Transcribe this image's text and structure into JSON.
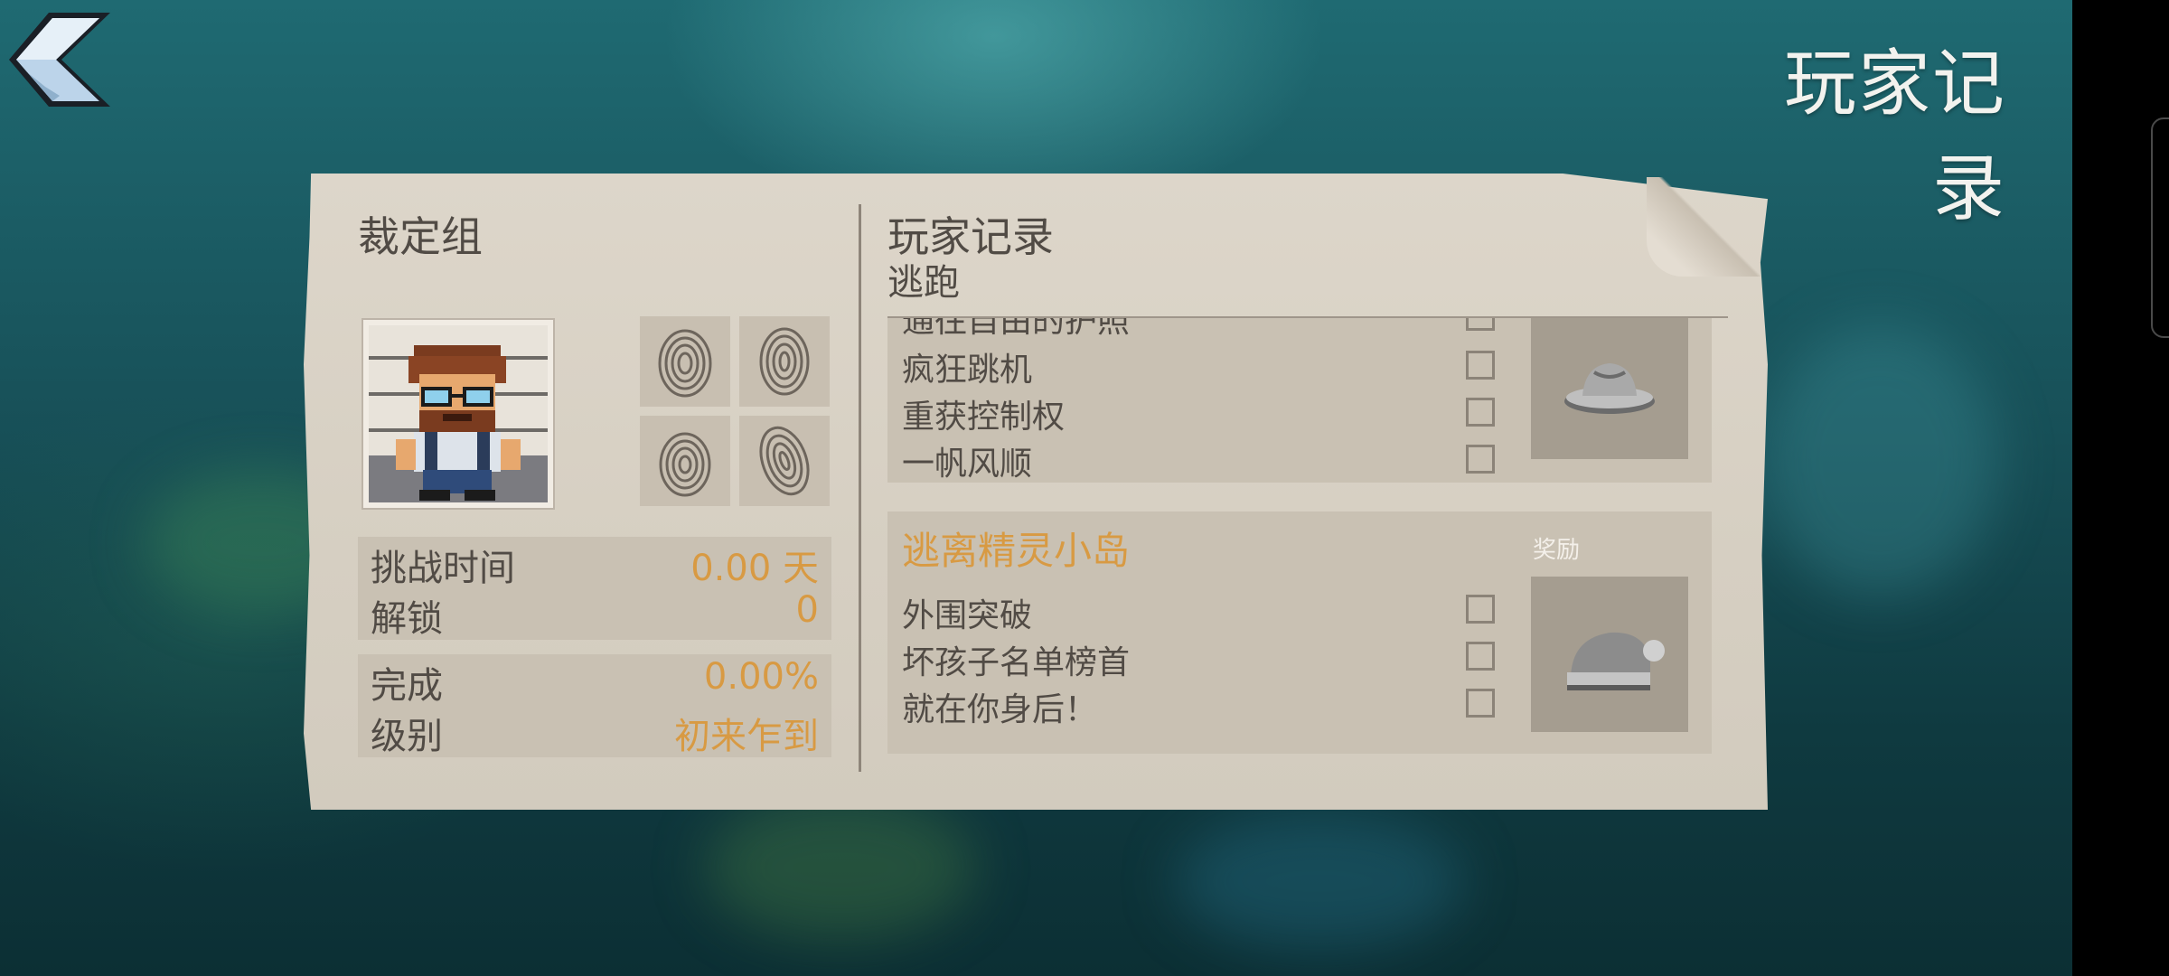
{
  "screen": {
    "title": "玩家记录"
  },
  "left_panel": {
    "title": "裁定组",
    "stats_a": [
      {
        "label": "挑战时间",
        "value": "0.00 天"
      },
      {
        "label": "解锁",
        "value": "0"
      }
    ],
    "stats_b": [
      {
        "label": "完成",
        "value": "0.00%"
      },
      {
        "label": "级别",
        "value": "初来乍到"
      }
    ]
  },
  "record_panel": {
    "title": "玩家记录",
    "subtitle": "逃跑",
    "partial_group": {
      "clipped_task": "通往自由的护照",
      "tasks": [
        "疯狂跳机",
        "重获控制权",
        "一帆风顺"
      ]
    },
    "group": {
      "title": "逃离精灵小岛",
      "reward_label": "奖励",
      "tasks": [
        "外围突破",
        "坏孩子名单榜首",
        "就在你身后！"
      ]
    }
  },
  "colors": {
    "accent_orange": "#d89a43",
    "paper": "#d6cfc2",
    "text_dark": "#514b45"
  },
  "icons": {
    "back": "back-chevron-icon",
    "reward_1": "fedora-hat-icon",
    "reward_2": "beanie-hat-icon",
    "prints": "fingerprint-icon"
  }
}
